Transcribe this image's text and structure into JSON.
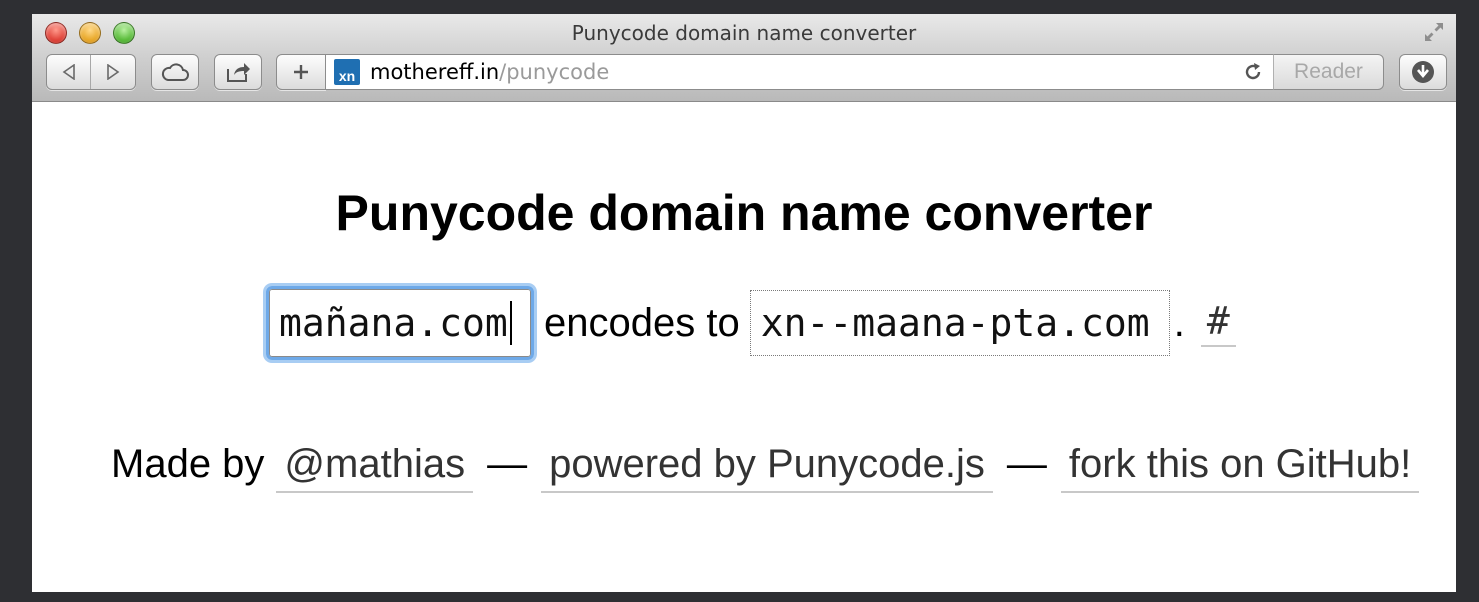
{
  "window": {
    "title": "Punycode domain name converter"
  },
  "toolbar": {
    "url_host": "mothereff.in",
    "url_path": "/punycode",
    "favicon_text": "xn",
    "reader_label": "Reader",
    "icons": [
      "back-icon",
      "forward-icon",
      "icloud-icon",
      "share-icon",
      "plus-icon",
      "reload-icon",
      "downloads-icon",
      "fullscreen-icon"
    ]
  },
  "page": {
    "heading": "Punycode domain name converter",
    "converter": {
      "input_value": "mañana.com",
      "middle_text": "encodes to",
      "output_value": "xn--maana-pta.com",
      "period": ".",
      "permalink": "#"
    },
    "footer": {
      "lead": "Made by",
      "author_link": "@mathias",
      "dash1": "—",
      "powered_link": "powered by Punycode.js",
      "dash2": "—",
      "fork_link": "fork this on GitHub!"
    }
  },
  "colors": {
    "focus_ring": "#6ea9e8",
    "favicon_bg": "#1f6fb2",
    "url_path": "#9a9a9a"
  }
}
